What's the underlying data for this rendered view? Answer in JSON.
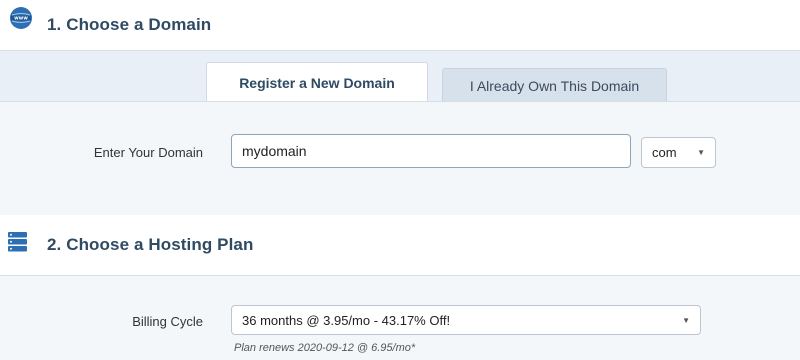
{
  "section1": {
    "title": "1. Choose a Domain",
    "icon": "www-globe-icon"
  },
  "tabs": [
    {
      "label": "Register a New Domain",
      "active": true
    },
    {
      "label": "I Already Own This Domain",
      "active": false
    }
  ],
  "domain": {
    "label": "Enter Your Domain",
    "value": "mydomain",
    "tld": "com"
  },
  "section2": {
    "title": "2. Choose a Hosting Plan",
    "icon": "server-stack-icon"
  },
  "billing": {
    "label": "Billing Cycle",
    "selected": "36 months @ 3.95/mo - 43.17% Off!",
    "note": "Plan renews 2020-09-12 @ 6.95/mo*"
  },
  "colors": {
    "heading": "#2f4a63",
    "band": "#f4f7fa",
    "tab_band": "#e8eff6",
    "icon_blue": "#2d6fb3"
  }
}
